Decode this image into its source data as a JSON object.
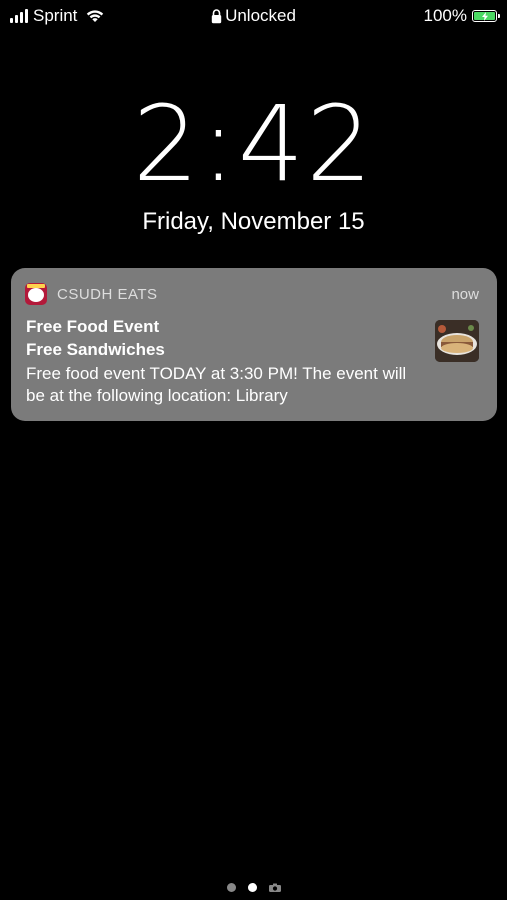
{
  "status_bar": {
    "carrier": "Sprint",
    "lock_status": "Unlocked",
    "battery_percent": "100%",
    "signal_strength": 4,
    "battery_level": 1.0,
    "battery_color": "#4cd964",
    "icons": [
      "signal-icon",
      "wifi-icon",
      "lock-icon",
      "battery-icon"
    ]
  },
  "lock_screen": {
    "time": "2:42",
    "date": "Friday, November 15"
  },
  "notification": {
    "app_name": "CSUDH EATS",
    "timestamp": "now",
    "title": "Free Food Event",
    "subtitle": "Free Sandwiches",
    "body": "Free food event TODAY at 3:30 PM! The event will be at the following location: Library",
    "app_icon": "csudh-eats-app-icon",
    "app_icon_color": "#b3193a",
    "attachment": "sandwich-thumbnail"
  },
  "page_indicator": {
    "pages": 2,
    "active_index": 1,
    "has_camera_page": true
  }
}
